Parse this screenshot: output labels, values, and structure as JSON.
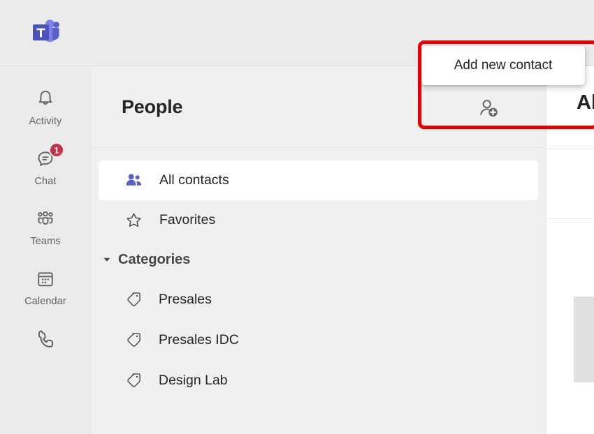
{
  "app": {
    "name": "Microsoft Teams",
    "logo_icon": "teams-logo-icon"
  },
  "rail": {
    "items": [
      {
        "label": "Activity",
        "icon": "bell-icon",
        "badge": null,
        "selected": false
      },
      {
        "label": "Chat",
        "icon": "chat-bubble-icon",
        "badge": "1",
        "selected": false
      },
      {
        "label": "Teams",
        "icon": "teams-people-icon",
        "badge": null,
        "selected": false
      },
      {
        "label": "Calendar",
        "icon": "calendar-icon",
        "badge": null,
        "selected": false
      },
      {
        "label": "",
        "icon": "phone-calls-icon",
        "badge": null,
        "selected": false
      }
    ]
  },
  "list_pane": {
    "title": "People",
    "add_contact": {
      "icon": "add-contact-icon",
      "tooltip": "Add new contact"
    },
    "items": [
      {
        "label": "All contacts",
        "icon": "people-filled-icon",
        "selected": true
      },
      {
        "label": "Favorites",
        "icon": "star-outline-icon",
        "selected": false
      }
    ],
    "group": {
      "label": "Categories",
      "expanded": true,
      "chevron_icon": "chevron-down-icon",
      "categories": [
        {
          "label": "Presales",
          "icon": "tag-icon"
        },
        {
          "label": "Presales IDC",
          "icon": "tag-icon"
        },
        {
          "label": "Design Lab",
          "icon": "tag-icon"
        }
      ]
    }
  },
  "content_pane": {
    "title": "All contacts"
  },
  "annotation": {
    "shape": "rectangle",
    "color": "#e20000",
    "target": "add-new-contact-button"
  },
  "colors": {
    "accent": "#5b5fc7",
    "badge": "#c4314b",
    "annotation": "#e20000",
    "chrome": "#ebebeb",
    "pane": "#f0f0f0",
    "text": "#252423",
    "muted_text": "#616161"
  }
}
